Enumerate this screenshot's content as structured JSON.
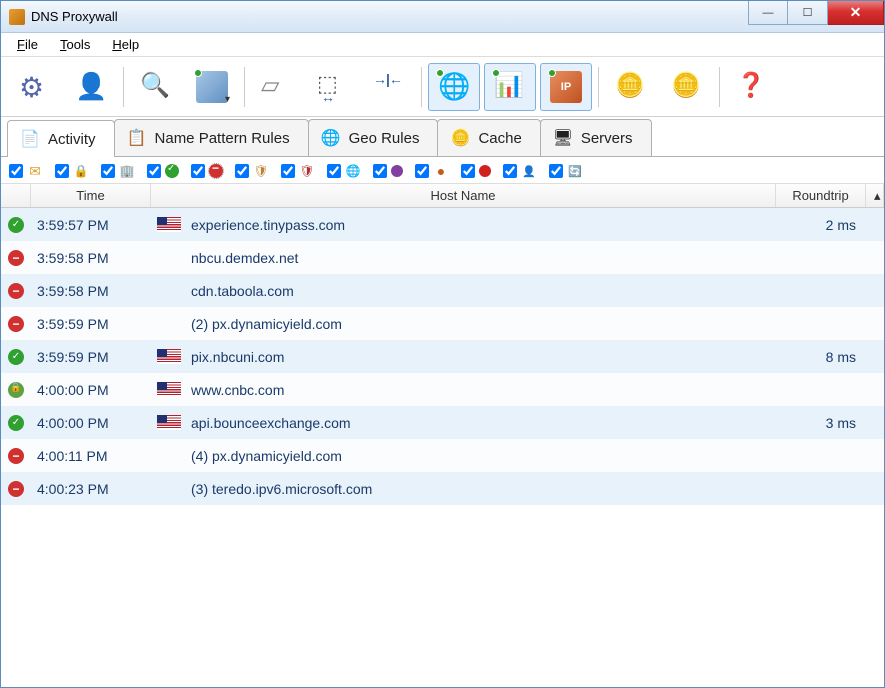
{
  "window": {
    "title": "DNS Proxywall"
  },
  "menu": {
    "file": "File",
    "tools": "Tools",
    "help": "Help"
  },
  "toolbar": [
    {
      "name": "settings-button",
      "icon": "ic-gear"
    },
    {
      "name": "user-button",
      "icon": "ic-user"
    },
    {
      "sep": true
    },
    {
      "name": "search-button",
      "icon": "ic-search"
    },
    {
      "name": "monitor-button",
      "icon": "ic-monitor",
      "badge": true
    },
    {
      "sep": true
    },
    {
      "name": "eraser-button",
      "icon": "ic-eraser"
    },
    {
      "name": "printer-width-button",
      "icon": "ic-printer"
    },
    {
      "name": "collapse-button",
      "icon": "ic-arrows"
    },
    {
      "sep": true
    },
    {
      "name": "globe-button",
      "icon": "ic-globe",
      "badge": true,
      "active": true
    },
    {
      "name": "stats-button",
      "icon": "ic-bars",
      "badge": true,
      "active": true
    },
    {
      "name": "ip-button",
      "icon": "ic-ip",
      "text": "IP",
      "badge": true,
      "active": true
    },
    {
      "sep": true
    },
    {
      "name": "cache-coins-button",
      "icon": "ic-coins"
    },
    {
      "name": "clean-coins-button",
      "icon": "ic-coins"
    },
    {
      "sep": true
    },
    {
      "name": "help-button",
      "icon": "ic-help"
    }
  ],
  "tabs": [
    {
      "name": "tab-activity",
      "label": "Activity",
      "icon": "📄",
      "active": true
    },
    {
      "name": "tab-name-pattern-rules",
      "label": "Name Pattern Rules",
      "icon": "📋"
    },
    {
      "name": "tab-geo-rules",
      "label": "Geo Rules",
      "icon": "🌐"
    },
    {
      "name": "tab-cache",
      "label": "Cache",
      "icon": "🪙"
    },
    {
      "name": "tab-servers",
      "label": "Servers",
      "icon": "🖥"
    }
  ],
  "filters": [
    {
      "icon": "fi-mail",
      "checked": true
    },
    {
      "icon": "fi-lock",
      "checked": true
    },
    {
      "icon": "fi-building",
      "checked": true
    },
    {
      "icon": "fi-check-green",
      "checked": true
    },
    {
      "icon": "fi-block-red",
      "checked": true,
      "selected": true
    },
    {
      "icon": "fi-shield",
      "checked": true
    },
    {
      "icon": "fi-shield-r",
      "checked": true
    },
    {
      "icon": "fi-globe-s",
      "checked": true
    },
    {
      "icon": "fi-purple",
      "checked": true
    },
    {
      "icon": "fi-ip-s",
      "checked": true
    },
    {
      "icon": "fi-red-dot",
      "checked": true
    },
    {
      "icon": "fi-person",
      "checked": true
    },
    {
      "icon": "fi-sync",
      "checked": true
    }
  ],
  "columns": {
    "time": "Time",
    "host": "Host Name",
    "roundtrip": "Roundtrip"
  },
  "rows": [
    {
      "status": "allow",
      "time": "3:59:57 PM",
      "flag": "us",
      "host": "experience.tinypass.com",
      "rt": "2 ms"
    },
    {
      "status": "block",
      "time": "3:59:58 PM",
      "flag": "",
      "host": "nbcu.demdex.net",
      "rt": ""
    },
    {
      "status": "block",
      "time": "3:59:58 PM",
      "flag": "",
      "host": "cdn.taboola.com",
      "rt": ""
    },
    {
      "status": "block",
      "time": "3:59:59 PM",
      "flag": "",
      "host": " (2) px.dynamicyield.com",
      "rt": ""
    },
    {
      "status": "allow",
      "time": "3:59:59 PM",
      "flag": "us",
      "host": "pix.nbcuni.com",
      "rt": "8 ms"
    },
    {
      "status": "lock",
      "time": "4:00:00 PM",
      "flag": "us",
      "host": "www.cnbc.com",
      "rt": ""
    },
    {
      "status": "allow",
      "time": "4:00:00 PM",
      "flag": "us",
      "host": "api.bounceexchange.com",
      "rt": "3 ms"
    },
    {
      "status": "block",
      "time": "4:00:11 PM",
      "flag": "",
      "host": " (4) px.dynamicyield.com",
      "rt": ""
    },
    {
      "status": "block",
      "time": "4:00:23 PM",
      "flag": "",
      "host": " (3) teredo.ipv6.microsoft.com",
      "rt": ""
    }
  ]
}
